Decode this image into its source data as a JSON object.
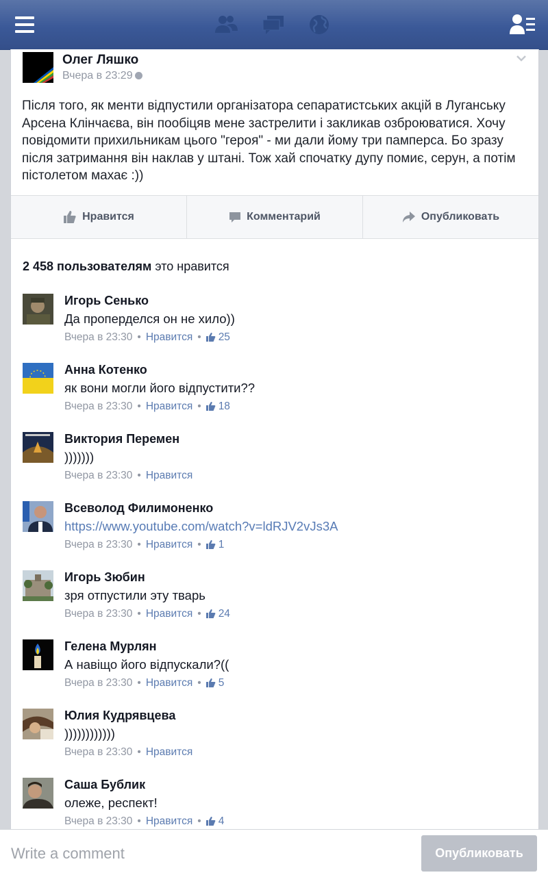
{
  "topbar": {
    "icons": [
      "menu-icon",
      "friend-requests-icon",
      "messages-icon",
      "notifications-globe-icon",
      "profile-list-icon"
    ],
    "color": "#3b5998"
  },
  "post": {
    "author": "Олег Ляшко",
    "time": "Вчера в 23:29",
    "text": "Після того, як менти відпустили організатора сепаратистських акцій в Луганську Арсена Клінчаєва, він пообіцяв мене застрелити і закликав озброюватися. Хочу повідомити прихильникам цього \"героя\" - ми дали йому три памперса. Бо зразу після затримання він наклав у штані. Тож хай спочатку дупу помиє, серун, а потім пістолетом махає :))",
    "actions": {
      "like": "Нравится",
      "comment": "Комментарий",
      "share": "Опубликовать"
    },
    "likes_count": "2 458 пользователям",
    "likes_suffix": "это нравится"
  },
  "comments": [
    {
      "name": "Игорь Сенько",
      "text": "Да проперделся он не хило))",
      "time": "Вчера в 23:30",
      "like": "Нравится",
      "count": "25"
    },
    {
      "name": "Анна Котенко",
      "text": "як вони могли його відпустити??",
      "time": "Вчера в 23:30",
      "like": "Нравится",
      "count": "18"
    },
    {
      "name": "Виктория Перемен",
      "text": ")))))))",
      "time": "Вчера в 23:30",
      "like": "Нравится",
      "count": null
    },
    {
      "name": "Всеволод Филимоненко",
      "text": "https://www.youtube.com/watch?v=ldRJV2vJs3A",
      "time": "Вчера в 23:30",
      "like": "Нравится",
      "count": "1"
    },
    {
      "name": "Игорь Зюбин",
      "text": "зря отпустили эту тварь",
      "time": "Вчера в 23:30",
      "like": "Нравится",
      "count": "24"
    },
    {
      "name": "Гелена Мурлян",
      "text": "А навіщо його відпускали?((",
      "time": "Вчера в 23:30",
      "like": "Нравится",
      "count": "5"
    },
    {
      "name": "Юлия Кудрявцева",
      "text": "))))))))))))",
      "time": "Вчера в 23:30",
      "like": "Нравится",
      "count": null
    },
    {
      "name": "Саша Бублик",
      "text": "олеже, респект!",
      "time": "Вчера в 23:30",
      "like": "Нравится",
      "count": "4"
    }
  ],
  "compose": {
    "placeholder": "Write a comment",
    "button": "Опубликовать"
  },
  "colors": {
    "link": "#5b7bb0",
    "meta": "#9197a3"
  }
}
